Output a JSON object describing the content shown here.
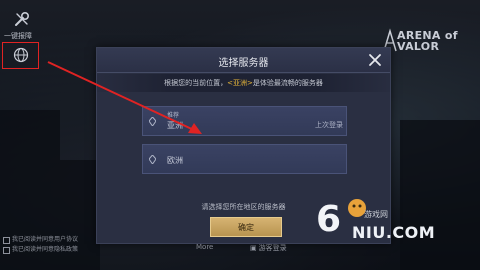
{
  "side": {
    "tool_label": "一键报障"
  },
  "logo": {
    "text_line1": "ARENA of",
    "text_line2": "VALOR"
  },
  "dialog": {
    "title": "选择服务器",
    "subtitle_prefix": "根据您的当前位置，",
    "subtitle_highlight": "<亚洲>",
    "subtitle_suffix": "是体验最流畅的服务器",
    "servers": [
      {
        "tag": "推荐",
        "name": "亚洲",
        "note": "上次登录"
      },
      {
        "tag": "",
        "name": "欧洲",
        "note": ""
      }
    ],
    "hint": "请选择您所在地区的服务器",
    "confirm_label": "确定"
  },
  "footer": {
    "more_label": "More",
    "guest_label": "游客登录",
    "notes": [
      "我已阅读并同意用户协议",
      "我已阅读并同意隐私政策"
    ]
  },
  "watermark": {
    "brand": "NIU.COM",
    "digit": "6",
    "cn": "游戏网"
  },
  "colors": {
    "highlight": "#e8b73a",
    "annotation": "#e02323",
    "confirm": "#d6b372"
  }
}
